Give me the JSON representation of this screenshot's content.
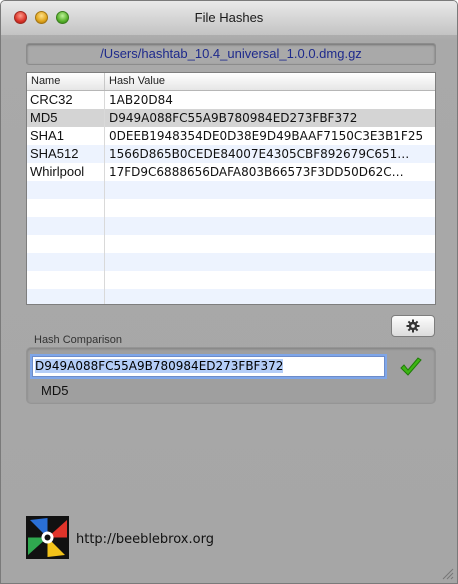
{
  "window": {
    "title": "File Hashes"
  },
  "file": {
    "path": "/Users/hashtab_10.4_universal_1.0.0.dmg.gz"
  },
  "table": {
    "columns": [
      "Name",
      "Hash Value"
    ],
    "rows": [
      {
        "name": "CRC32",
        "hash": "1AB20D84"
      },
      {
        "name": "MD5",
        "hash": "D949A088FC55A9B780984ED273FBF372"
      },
      {
        "name": "SHA1",
        "hash": "0DEEB1948354DE0D38E9D49BAAF7150C3E3B1F25"
      },
      {
        "name": "SHA512",
        "hash": "1566D865B0CEDE84007E4305CBF892679C651…"
      },
      {
        "name": "Whirlpool",
        "hash": "17FD9C6888656DAFA803B66573F3DD50D62C…"
      }
    ],
    "selected_row": 1
  },
  "comparison": {
    "label": "Hash Comparison",
    "input_value": "D949A088FC55A9B780984ED273FBF372",
    "match_name": "MD5",
    "match_icon": "checkmark-icon",
    "match_color": "#3db614"
  },
  "footer": {
    "url": "http://beeblebrox.org"
  }
}
